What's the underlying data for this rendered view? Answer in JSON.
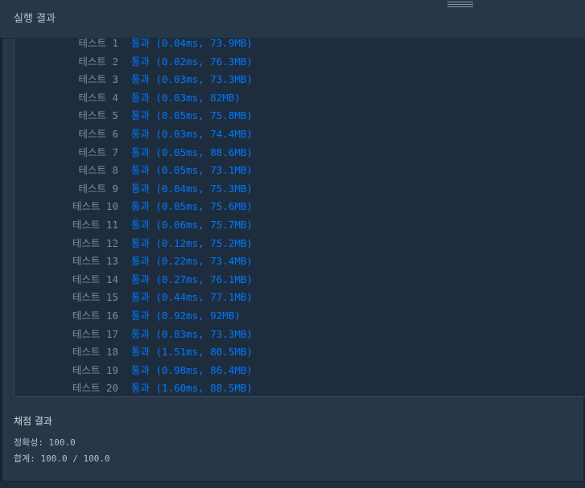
{
  "header": {
    "title": "실행 결과"
  },
  "tests": [
    {
      "label": "테스트 1",
      "result": "통과 (0.04ms, 73.9MB)"
    },
    {
      "label": "테스트 2",
      "result": "통과 (0.02ms, 76.3MB)"
    },
    {
      "label": "테스트 3",
      "result": "통과 (0.03ms, 73.3MB)"
    },
    {
      "label": "테스트 4",
      "result": "통과 (0.03ms, 82MB)"
    },
    {
      "label": "테스트 5",
      "result": "통과 (0.05ms, 75.8MB)"
    },
    {
      "label": "테스트 6",
      "result": "통과 (0.03ms, 74.4MB)"
    },
    {
      "label": "테스트 7",
      "result": "통과 (0.05ms, 88.6MB)"
    },
    {
      "label": "테스트 8",
      "result": "통과 (0.05ms, 73.1MB)"
    },
    {
      "label": "테스트 9",
      "result": "통과 (0.04ms, 75.3MB)"
    },
    {
      "label": "테스트 10",
      "result": "통과 (0.05ms, 75.6MB)"
    },
    {
      "label": "테스트 11",
      "result": "통과 (0.06ms, 75.7MB)"
    },
    {
      "label": "테스트 12",
      "result": "통과 (0.12ms, 75.2MB)"
    },
    {
      "label": "테스트 13",
      "result": "통과 (0.22ms, 73.4MB)"
    },
    {
      "label": "테스트 14",
      "result": "통과 (0.27ms, 76.1MB)"
    },
    {
      "label": "테스트 15",
      "result": "통과 (0.44ms, 77.1MB)"
    },
    {
      "label": "테스트 16",
      "result": "통과 (0.92ms, 92MB)"
    },
    {
      "label": "테스트 17",
      "result": "통과 (0.83ms, 73.3MB)"
    },
    {
      "label": "테스트 18",
      "result": "통과 (1.51ms, 80.5MB)"
    },
    {
      "label": "테스트 19",
      "result": "통과 (0.98ms, 86.4MB)"
    },
    {
      "label": "테스트 20",
      "result": "통과 (1.60ms, 88.5MB)"
    }
  ],
  "grading": {
    "title": "채점 결과",
    "accuracy": "정확성: 100.0",
    "total": "합계: 100.0 / 100.0"
  },
  "icons": {
    "row_separator": "chevron-right-icon",
    "resize": "drag-handle-icon"
  },
  "colors": {
    "pass": "#0078ff",
    "label": "#78909c",
    "background": "#263747",
    "results_bg": "#1e2d3d"
  }
}
